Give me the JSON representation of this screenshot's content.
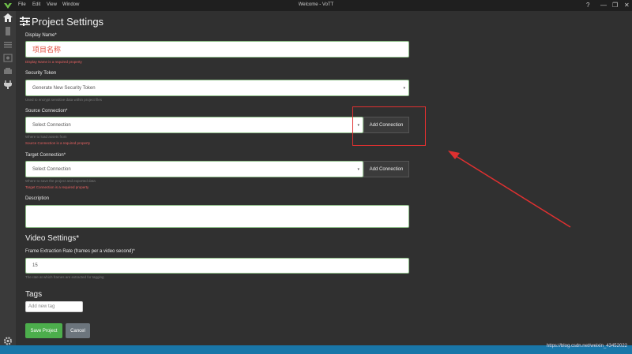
{
  "titlebar": {
    "menus": [
      "File",
      "Edit",
      "View",
      "Window"
    ],
    "title": "Welcome - VoTT",
    "buttons": [
      "?",
      "—",
      "❐",
      "✕"
    ]
  },
  "sidebar": {
    "icons": [
      "home-icon",
      "bookmark-icon",
      "list-icon",
      "image-icon",
      "export-icon",
      "plug-icon",
      "settings-icon"
    ]
  },
  "page": {
    "title": "Project Settings",
    "display_name": {
      "label": "Display Name*",
      "value": "项目名称",
      "error": "Display Name is a required property"
    },
    "security_token": {
      "label": "Security Token",
      "value": "Generate New Security Token",
      "help": "Used to encrypt sensitive data within project files"
    },
    "source_connection": {
      "label": "Source Connection*",
      "value": "Select Connection",
      "help": "Where to load assets from",
      "error": "Source Connection is a required property",
      "add_button": "Add Connection"
    },
    "target_connection": {
      "label": "Target Connection*",
      "value": "Select Connection",
      "help": "Where to save the project and exported data",
      "error": "Target Connection is a required property",
      "add_button": "Add Connection"
    },
    "description": {
      "label": "Description",
      "value": ""
    },
    "video_settings": {
      "title": "Video Settings*",
      "frame_rate_label": "Frame Extraction Rate (frames per a video second)*",
      "frame_rate_value": "15",
      "help": "The rate at which frames are extracted for tagging"
    },
    "tags": {
      "title": "Tags",
      "placeholder": "Add new tag"
    },
    "save_button": "Save Project",
    "cancel_button": "Cancel"
  },
  "watermark": "https://blog.csdn.net/weixin_43452022",
  "colors": {
    "annotation": "#e03030",
    "save_button": "#4cae4c",
    "status_bar": "#1976a8"
  }
}
